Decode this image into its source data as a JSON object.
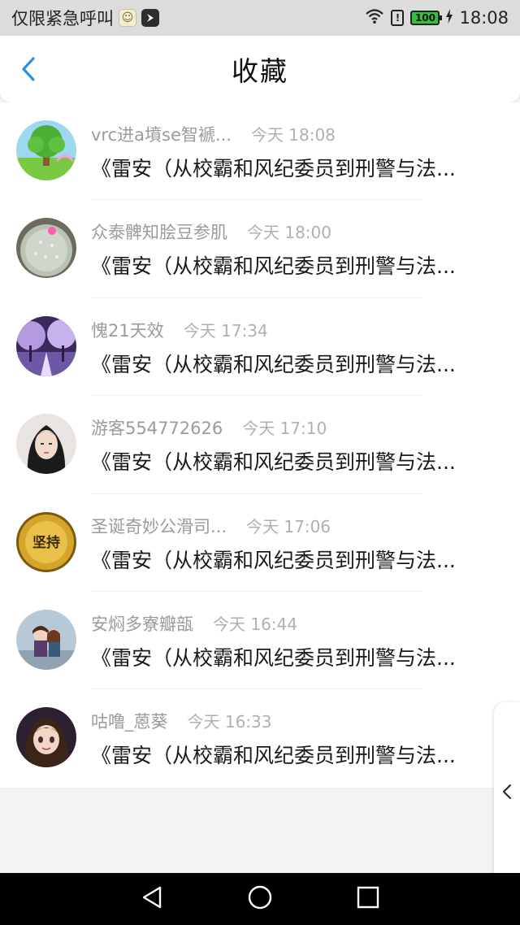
{
  "status_bar": {
    "carrier_text": "仅限紧急呼叫",
    "battery_level": "100",
    "time": "18:08",
    "icons": [
      "emoji-app-icon",
      "bird-app-icon",
      "wifi-icon",
      "alert-icon",
      "battery-icon",
      "charging-icon"
    ]
  },
  "header": {
    "title": "收藏",
    "back_icon": "chevron-left-icon",
    "accent_color": "#2f8fe0"
  },
  "favorites": [
    {
      "user": "vrc进a墳se智褫...",
      "time": "今天 18:08",
      "title": "《雷安（从校霸和风纪委员到刑警与法...",
      "avatar": "tree-landscape"
    },
    {
      "user": "众泰髀知脍豆参肌",
      "time": "今天 18:00",
      "title": "《雷安（从校霸和风纪委员到刑警与法...",
      "avatar": "cactus"
    },
    {
      "user": "愧21天效",
      "time": "今天 17:34",
      "title": "《雷安（从校霸和风纪委员到刑警与法...",
      "avatar": "purple-trees"
    },
    {
      "user": "游客554772626",
      "time": "今天 17:10",
      "title": "《雷安（从校霸和风纪委员到刑警与法...",
      "avatar": "girl-portrait"
    },
    {
      "user": "圣诞奇妙公滑司...",
      "time": "今天 17:06",
      "title": "《雷安（从校霸和风纪委员到刑警与法...",
      "avatar": "gold-badge",
      "avatar_text": "坚持"
    },
    {
      "user": "安焖多寮瓣瓿",
      "time": "今天 16:44",
      "title": "《雷安（从校霸和风纪委员到刑警与法...",
      "avatar": "couple"
    },
    {
      "user": "咕噜_蒽葵",
      "time": "今天 16:33",
      "title": "《雷安（从校霸和风纪委员到刑警与法...",
      "avatar": "anime-girl"
    }
  ],
  "side_handle": {
    "icon": "chevron-left-icon"
  },
  "nav_bar": {
    "icons": [
      "back-triangle-icon",
      "home-circle-icon",
      "recents-square-icon"
    ]
  }
}
